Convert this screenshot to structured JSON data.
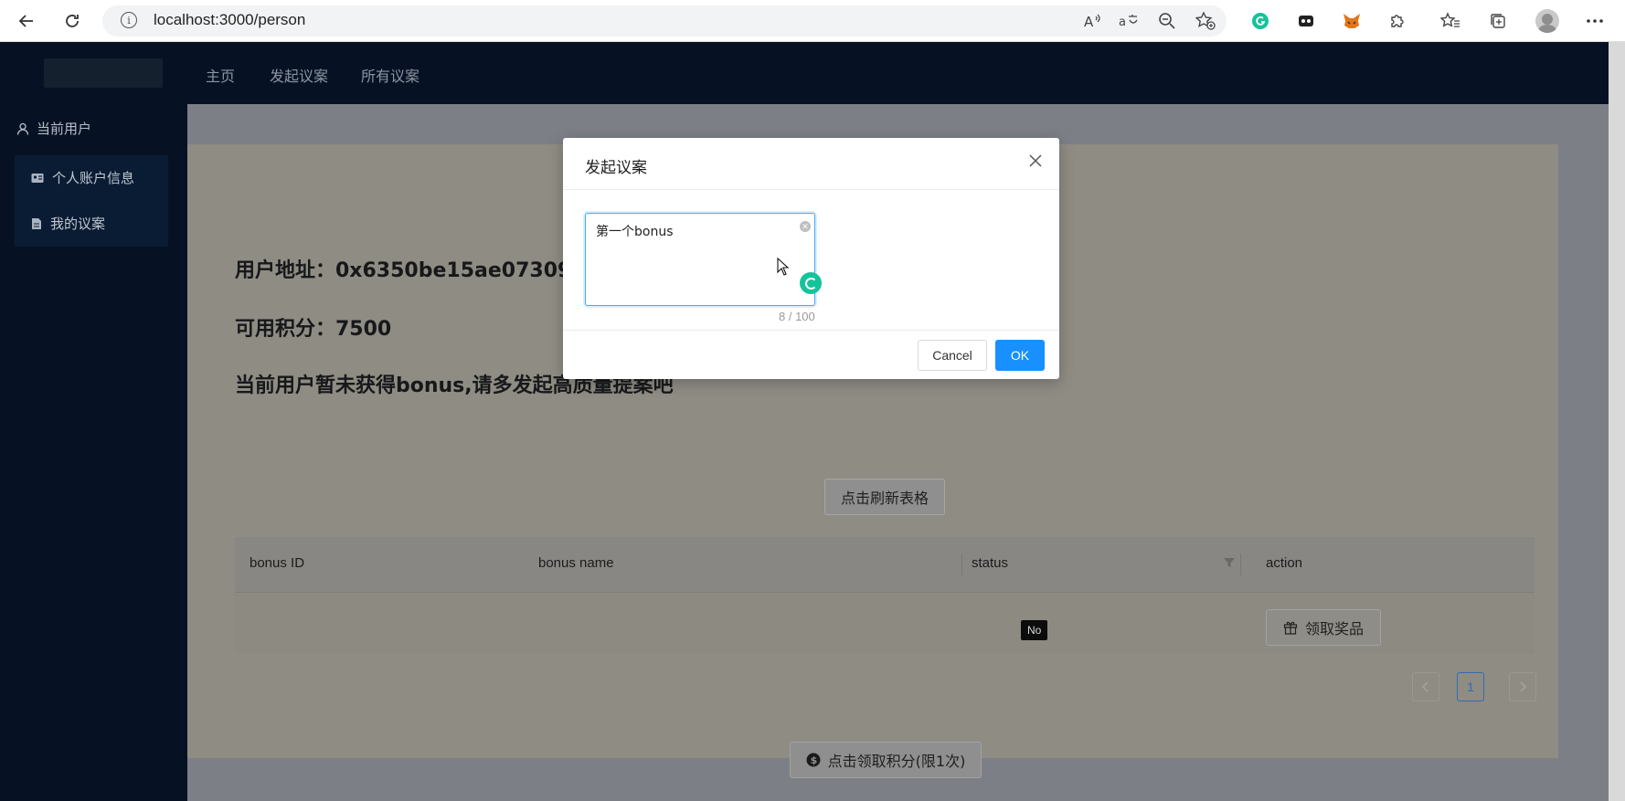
{
  "browser": {
    "url": "localhost:3000/person"
  },
  "header": {
    "nav": [
      "主页",
      "发起议案",
      "所有议案"
    ]
  },
  "sidebar": {
    "current_user": "当前用户",
    "items": [
      {
        "label": "个人账户信息"
      },
      {
        "label": "我的议案"
      }
    ]
  },
  "main": {
    "address_line": "用户地址：0x6350be15ae07309",
    "points_line": "可用积分：7500",
    "bonus_notice": "当前用户暂未获得bonus,请多发起高质量提案吧",
    "refresh_button": "点击刷新表格",
    "table": {
      "columns": [
        "bonus ID",
        "bonus name",
        "status",
        "action"
      ],
      "rows": [
        {
          "bonus_id": "",
          "bonus_name": "",
          "status": "No",
          "action": "领取奖品"
        }
      ]
    },
    "pagination": {
      "current": "1"
    },
    "claim_points_button": "点击领取积分(限1次)"
  },
  "modal": {
    "title": "发起议案",
    "textarea_value": "第一个bonus",
    "char_count": "8 / 100",
    "cancel": "Cancel",
    "ok": "OK"
  },
  "colors": {
    "primary": "#1890ff",
    "header_bg": "#061224",
    "grammarly": "#15c39a"
  }
}
